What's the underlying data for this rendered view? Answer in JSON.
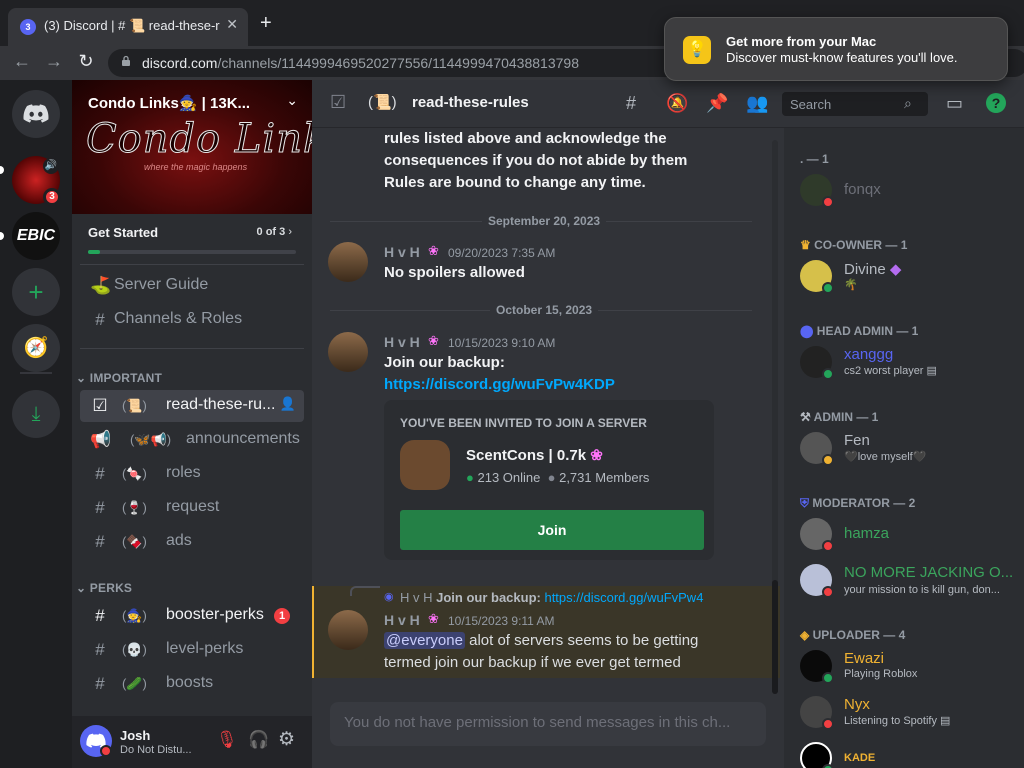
{
  "browser": {
    "tab_title": "(3) Discord | # 📜 read-these-rules",
    "tab_badge": "3",
    "url_host": "discord.com",
    "url_path": "/channels/1144999469520277556/1144999470438813798"
  },
  "notification": {
    "title": "Get more from your Mac",
    "subtitle": "Discover must-know features you'll love."
  },
  "rail": {
    "servers": [
      {
        "name": "Discord Home",
        "badge": ""
      },
      {
        "name": "Condo Links",
        "badge": "3"
      },
      {
        "name": "EBIC",
        "badge": ""
      }
    ],
    "ebic_label": "EBIC"
  },
  "server": {
    "name": "Condo Links🧙 | 13K...",
    "banner_logo": "Condo Links",
    "banner_tagline": "where the magic happens",
    "get_started": "Get Started",
    "progress_text": "0 of 3",
    "progress_fraction": 0.06,
    "server_guide": "Server Guide",
    "channels_roles": "Channels & Roles"
  },
  "categories": {
    "important": "IMPORTANT",
    "perks": "PERKS"
  },
  "channels": {
    "read_rules": "read-these-ru...",
    "announcements": "announcements",
    "roles": "roles",
    "request": "request",
    "ads": "ads",
    "booster_perks": "booster-perks",
    "booster_badge": "1",
    "level_perks": "level-perks",
    "boosts": "boosts"
  },
  "user": {
    "name": "Josh",
    "status": "Do Not Distu..."
  },
  "header": {
    "channel": "read-these-rules",
    "search_placeholder": "Search"
  },
  "messages": {
    "rules_text": [
      "rules listed above and acknowledge the",
      "consequences if you do not abide by them",
      "Rules are bound to change any time."
    ],
    "date1": "September 20, 2023",
    "m1_author": "H v H",
    "m1_time": "09/20/2023 7:35 AM",
    "m1_body": "No spoilers allowed",
    "date2": "October 15, 2023",
    "m2_author": "H v H",
    "m2_time": "10/15/2023 9:10 AM",
    "m2_body": "Join our backup:",
    "m2_link": "https://discord.gg/wuFvPw4KDP",
    "invite_header": "YOU'VE BEEN INVITED TO JOIN A SERVER",
    "invite_name": "ScentCons | 0.7k",
    "invite_online": "213 Online",
    "invite_members": "2,731 Members",
    "invite_join": "Join",
    "reply_author": "H v H",
    "reply_text": "Join our backup: ",
    "reply_link": "https://discord.gg/wuFvPw4",
    "m3_author": "H v H",
    "m3_time": "10/15/2023 9:11 AM",
    "m3_mention": "@everyone",
    "m3_body1": " alot of servers seems to be getting",
    "m3_body2": "termed join our backup if we ever get termed",
    "composer": "You do not have permission to send messages in this ch..."
  },
  "members": {
    "roles": [
      {
        "label": ". — 1"
      },
      {
        "label": "CO-OWNER — 1"
      },
      {
        "label": "HEAD ADMIN — 1"
      },
      {
        "label": "ADMIN — 1"
      },
      {
        "label": "MODERATOR — 2"
      },
      {
        "label": "UPLOADER — 4"
      }
    ],
    "list": [
      {
        "name": "fonqx",
        "status": "",
        "color": "#6d6f78"
      },
      {
        "name": "Divine",
        "status": "🌴",
        "color": "#b5bac1"
      },
      {
        "name": "xanggg",
        "status": "cs2 worst player",
        "color": "#5865f2"
      },
      {
        "name": "Fen",
        "status": "🖤love myself🖤",
        "color": "#b5bac1"
      },
      {
        "name": "hamza",
        "status": "",
        "color": "#3ba55d"
      },
      {
        "name": "NO MORE JACKING O...",
        "status": "your mission to is kill gun, don...",
        "color": "#3ba55d"
      },
      {
        "name": "Ewazi",
        "status": "Playing Roblox",
        "color": "#f0b232"
      },
      {
        "name": "Nyx",
        "status": "Listening to Spotify",
        "color": "#f0b232"
      },
      {
        "name": "KADE",
        "status": "",
        "color": "#f0b232"
      }
    ]
  }
}
